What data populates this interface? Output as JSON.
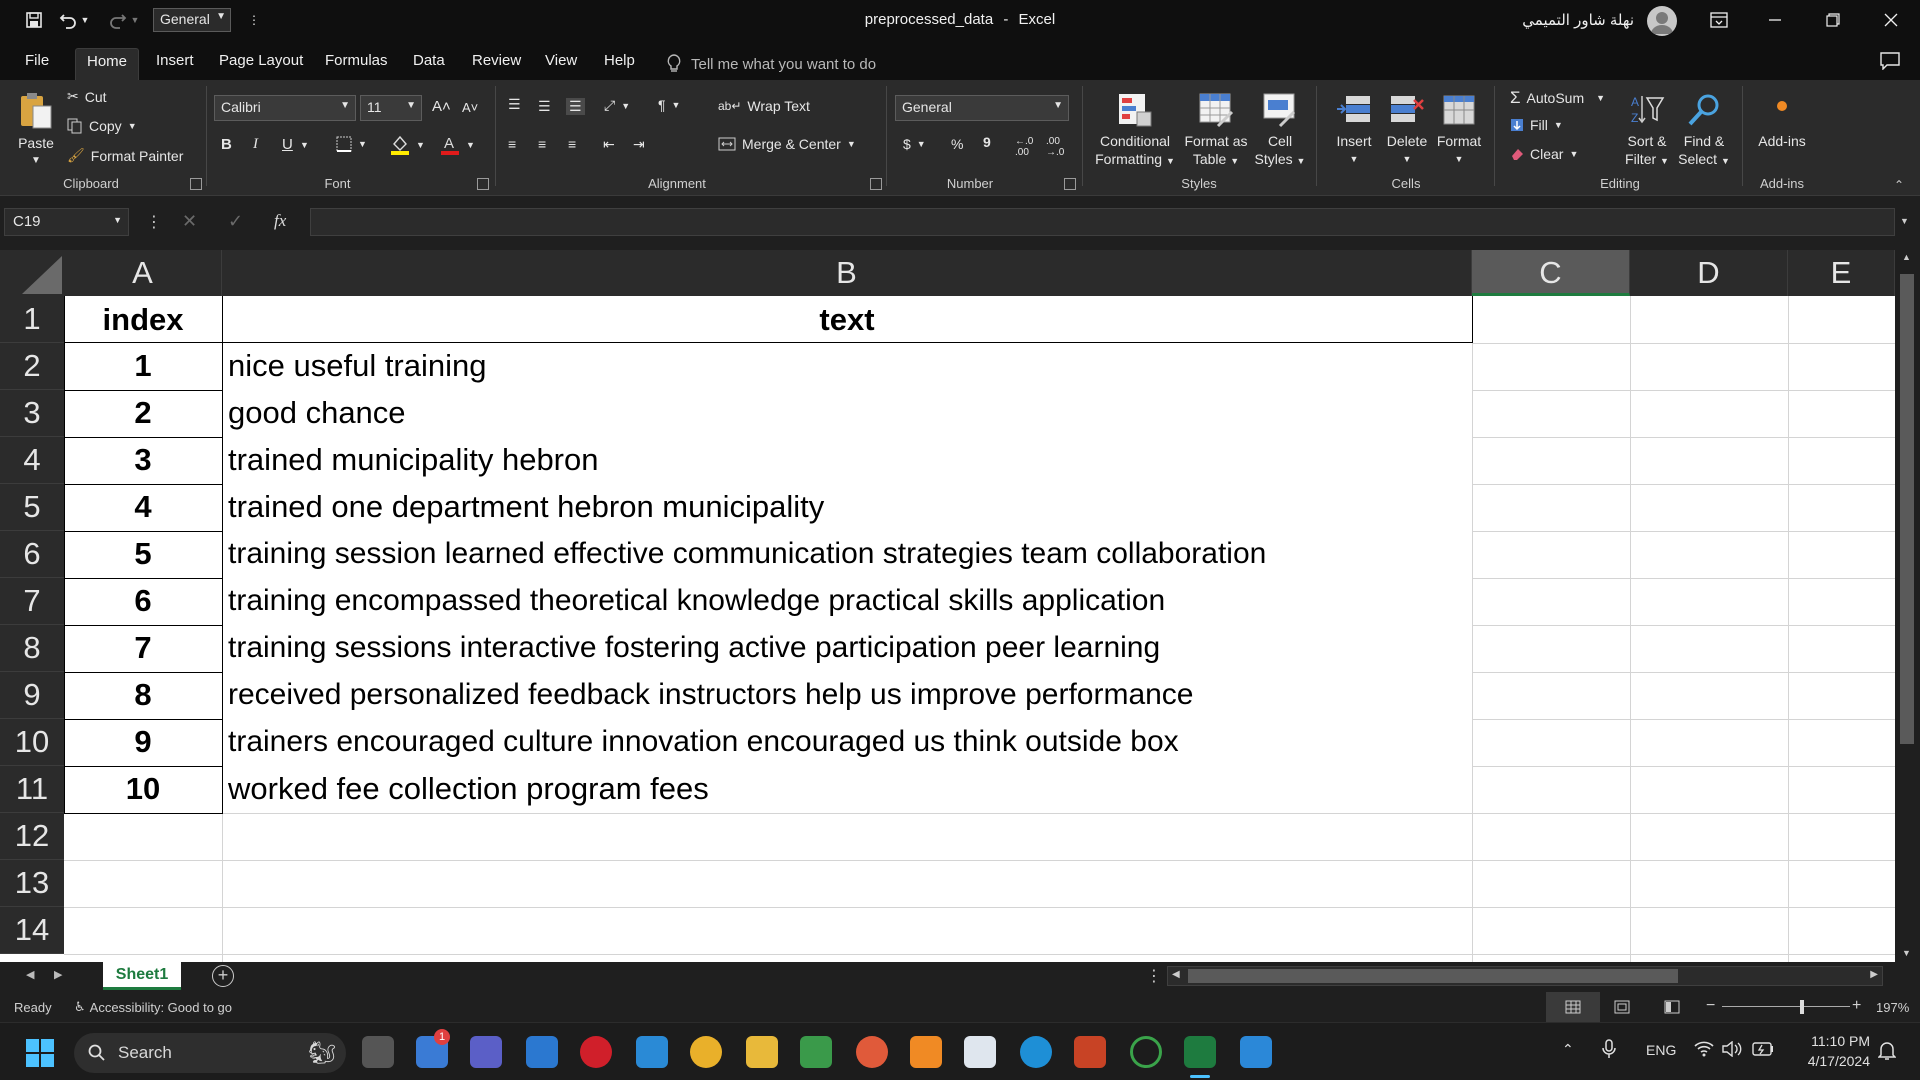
{
  "titlebar": {
    "style_value": "General",
    "document": "preprocessed_data",
    "separator": "-",
    "app": "Excel",
    "user": "نهلة شاور التميمي"
  },
  "menu": {
    "tabs": [
      "File",
      "Home",
      "Insert",
      "Page Layout",
      "Formulas",
      "Data",
      "Review",
      "View",
      "Help"
    ],
    "active": "Home",
    "tell_me": "Tell me what you want to do"
  },
  "ribbon": {
    "clipboard": {
      "paste": "Paste",
      "cut": "Cut",
      "copy": "Copy",
      "format_painter": "Format Painter",
      "label": "Clipboard"
    },
    "font": {
      "name": "Calibri",
      "size": "11",
      "bold": "B",
      "italic": "I",
      "underline": "U",
      "label": "Font"
    },
    "alignment": {
      "wrap_text": "Wrap Text",
      "merge_center": "Merge & Center",
      "label": "Alignment"
    },
    "number": {
      "format": "General",
      "currency": "$",
      "percent": "%",
      "comma": "9",
      "label": "Number"
    },
    "styles": {
      "conditional_1": "Conditional",
      "conditional_2": "Formatting",
      "format_table_1": "Format as",
      "format_table_2": "Table",
      "cell_styles_1": "Cell",
      "cell_styles_2": "Styles",
      "label": "Styles"
    },
    "cells": {
      "insert": "Insert",
      "delete": "Delete",
      "format": "Format",
      "label": "Cells"
    },
    "editing": {
      "autosum": "AutoSum",
      "fill": "Fill",
      "clear": "Clear",
      "sort_1": "Sort &",
      "sort_2": "Filter",
      "find_1": "Find &",
      "find_2": "Select",
      "label": "Editing"
    },
    "addins": {
      "addins": "Add-ins",
      "label": "Add-ins"
    }
  },
  "formula_bar": {
    "name_box": "C19",
    "fx": "fx",
    "value": ""
  },
  "sheet": {
    "columns": [
      "A",
      "B",
      "C",
      "D",
      "E"
    ],
    "selected_column": "C",
    "row_numbers": [
      "1",
      "2",
      "3",
      "4",
      "5",
      "6",
      "7",
      "8",
      "9",
      "10",
      "11",
      "12",
      "13",
      "14"
    ],
    "header": {
      "index": "index",
      "text": "text"
    },
    "rows": [
      {
        "index": "1",
        "text": "nice useful training"
      },
      {
        "index": "2",
        "text": "good chance"
      },
      {
        "index": "3",
        "text": "trained municipality hebron"
      },
      {
        "index": "4",
        "text": "trained one department hebron municipality"
      },
      {
        "index": "5",
        "text": "training session learned effective communication strategies team collaboration"
      },
      {
        "index": "6",
        "text": "training encompassed theoretical knowledge practical skills application"
      },
      {
        "index": "7",
        "text": "training sessions interactive fostering active participation peer learning"
      },
      {
        "index": "8",
        "text": "received personalized feedback instructors help us improve performance"
      },
      {
        "index": "9",
        "text": "trainers encouraged culture innovation encouraged us think outside box"
      },
      {
        "index": "10",
        "text": "worked fee collection program fees"
      }
    ],
    "tab_name": "Sheet1"
  },
  "status": {
    "ready": "Ready",
    "accessibility": "Accessibility: Good to go",
    "zoom": "197%"
  },
  "taskbar": {
    "search": "Search",
    "language": "ENG",
    "time": "11:10 PM",
    "date": "4/17/2024",
    "badge": "1"
  },
  "colors": {
    "accent_green": "#1e7b3f",
    "ribbon_bg": "#2b2b2b",
    "title_bg": "#0f0f0f"
  }
}
